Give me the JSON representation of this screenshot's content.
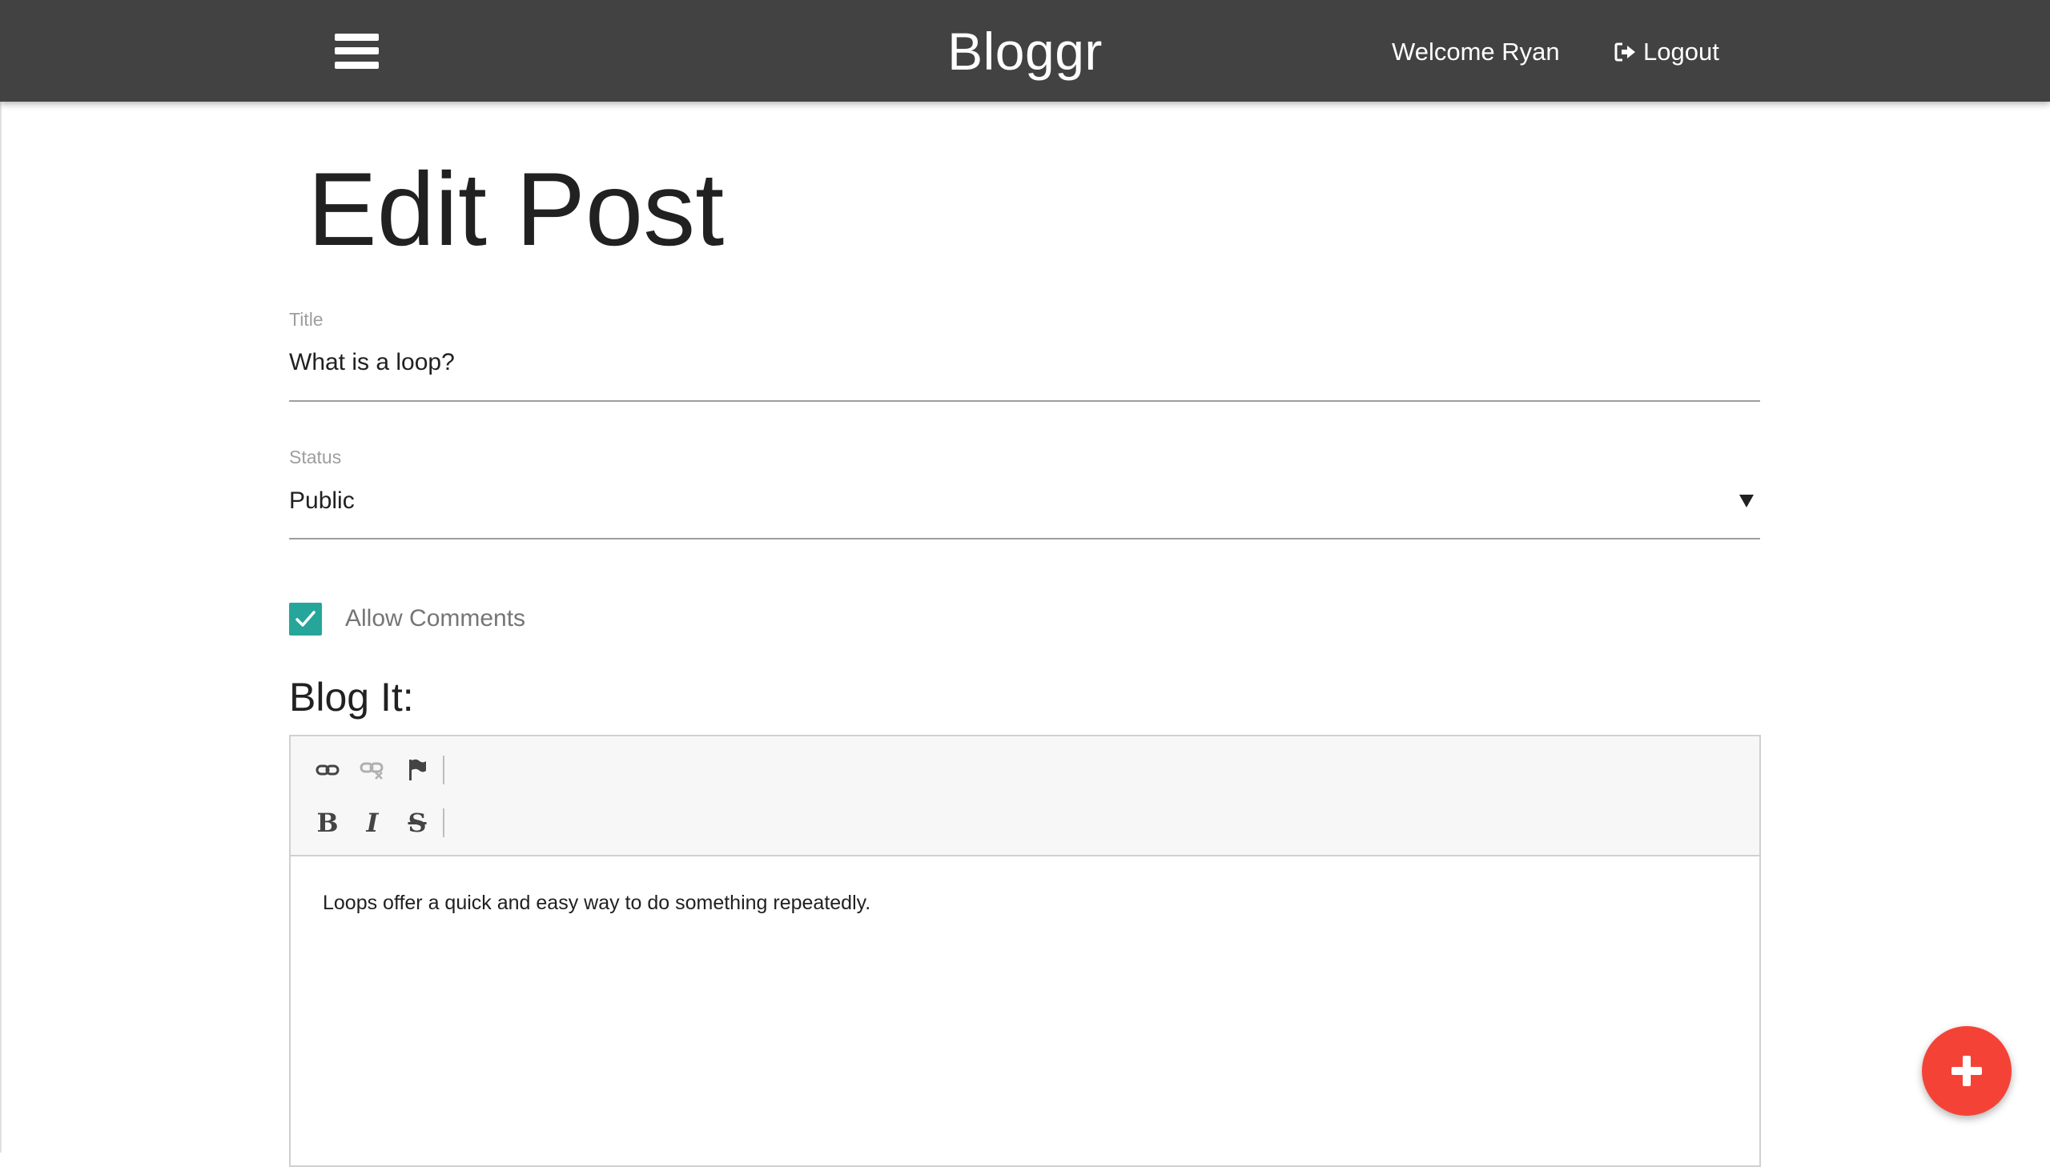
{
  "header": {
    "brand": "Bloggr",
    "welcome_text": "Welcome Ryan",
    "logout_label": "Logout",
    "background_color": "#424242"
  },
  "page": {
    "title": "Edit Post"
  },
  "form": {
    "title_label": "Title",
    "title_value": "What is a loop?",
    "status_label": "Status",
    "status_value": "Public",
    "allow_comments_label": "Allow Comments",
    "allow_comments_checked": true,
    "checkbox_color": "#26a69a"
  },
  "editor": {
    "heading": "Blog It:",
    "toolbar": {
      "row1": [
        "link-icon",
        "unlink-icon",
        "anchor-flag-icon"
      ],
      "row2": [
        {
          "name": "bold-button",
          "glyph": "B"
        },
        {
          "name": "italic-button",
          "glyph": "I"
        },
        {
          "name": "strikethrough-button",
          "glyph": "S"
        }
      ]
    },
    "content": "Loops offer a quick and easy way to do something repeatedly."
  },
  "fab": {
    "icon": "plus-icon",
    "color": "#f44336"
  }
}
